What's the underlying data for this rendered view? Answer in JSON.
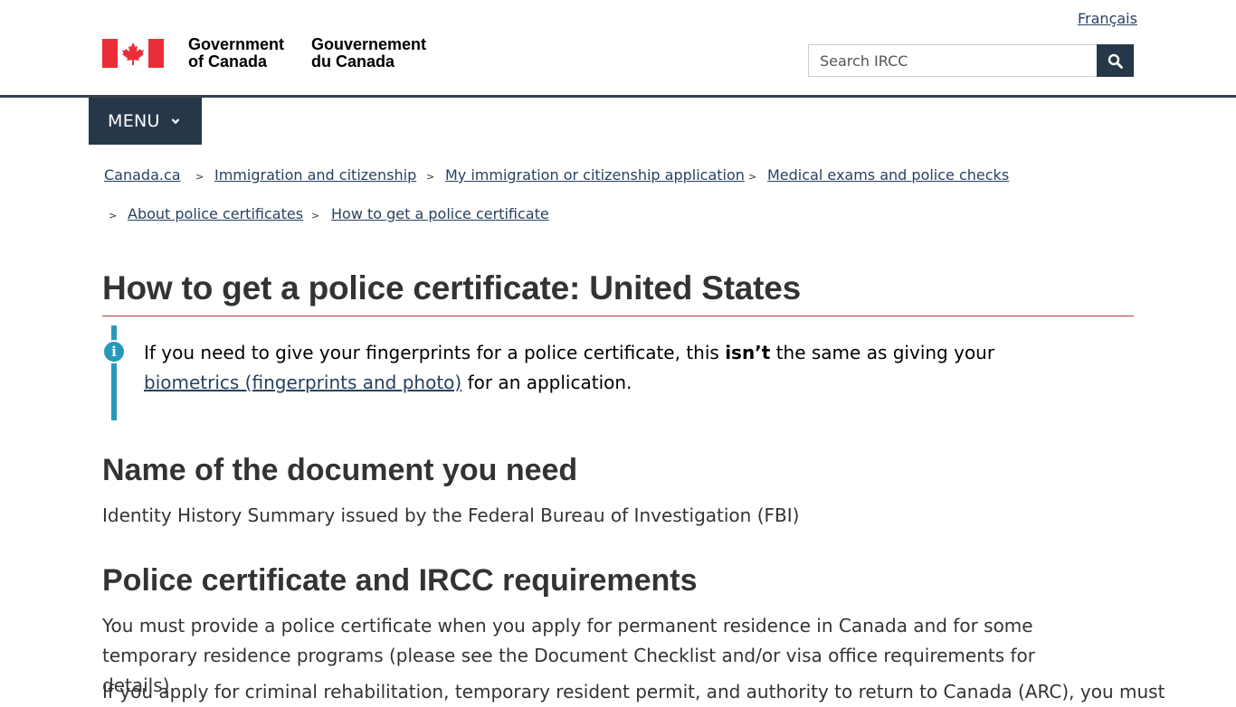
{
  "header": {
    "language_link": "Français",
    "gov_en_line1": "Government",
    "gov_en_line2": "of Canada",
    "gov_fr_line1": "Gouvernement",
    "gov_fr_line2": "du Canada",
    "search_placeholder": "Search IRCC",
    "search_icon": "search-icon"
  },
  "menu": {
    "label": "MENU",
    "icon": "chevron-down-icon"
  },
  "breadcrumbs": [
    "Canada.ca",
    "Immigration and citizenship",
    "My immigration or citizenship application",
    "Medical exams and police checks",
    "About police certificates",
    "How to get a police certificate"
  ],
  "breadcrumb_separator": ">",
  "main": {
    "title": "How to get a police certificate: United States",
    "alert": {
      "icon": "info-icon",
      "text_before": "If you need to give your fingerprints for a police certificate, this ",
      "text_bold": "isn’t",
      "text_middle": " the same as giving your ",
      "link_text": "biometrics (fingerprints and photo)",
      "text_after": " for an application."
    },
    "section1_heading": "Name of the document you need",
    "section1_text": "Identity History Summary issued by the Federal Bureau of Investigation (FBI)",
    "section2_heading": "Police certificate and IRCC requirements",
    "section2_text": "You must provide a police certificate when you apply for permanent residence in Canada and for some temporary residence programs (please see the Document Checklist and/or visa office requirements for details).",
    "section2_text2": "If you apply for criminal rehabilitation, temporary resident permit, and authority to return to Canada (ARC), you must"
  },
  "colors": {
    "brand_dark": "#26374a",
    "link": "#284162",
    "accent_red": "#af3c43",
    "info_blue": "#269abc",
    "flag_red": "#eb2d37"
  }
}
